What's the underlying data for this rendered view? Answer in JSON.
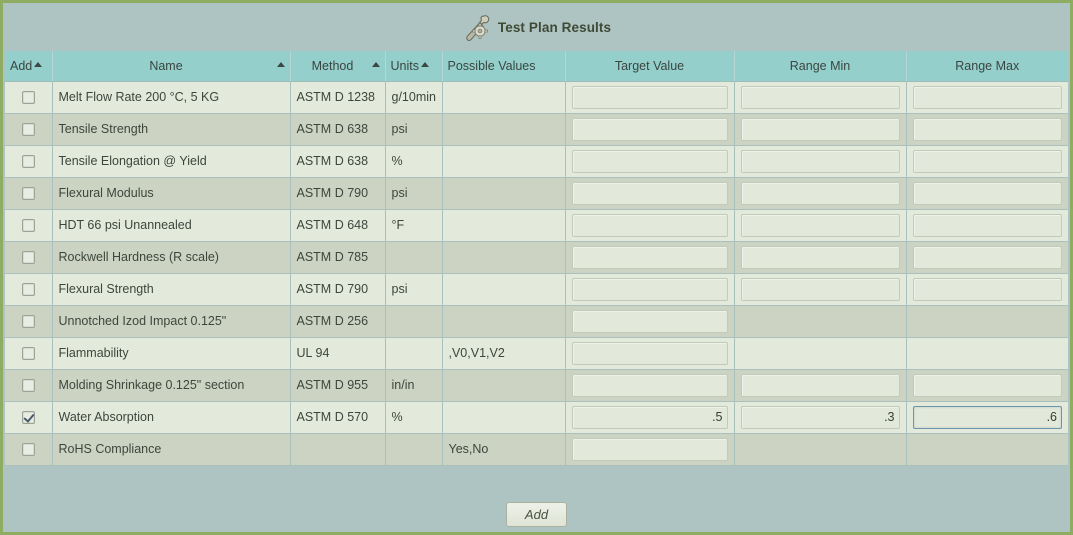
{
  "header": {
    "title": "Test Plan Results",
    "icon": "wrench-gear-icon"
  },
  "colors": {
    "page_background": "#aec4c2",
    "outer_border": "#8fad62",
    "header_row": "#95cfcc",
    "row_odd": "#e3e9db",
    "row_even": "#ccd3c3",
    "input_background": "#e2e8da",
    "focus_border": "#6d94a7",
    "text": "#3c463c"
  },
  "table": {
    "columns": [
      {
        "key": "add",
        "label": "Add",
        "sortable": true,
        "sort": "asc",
        "align": "left"
      },
      {
        "key": "name",
        "label": "Name",
        "sortable": true,
        "sort": "asc",
        "align": "center"
      },
      {
        "key": "method",
        "label": "Method",
        "sortable": true,
        "sort": "asc",
        "align": "center"
      },
      {
        "key": "units",
        "label": "Units",
        "sortable": true,
        "sort": "asc",
        "align": "left"
      },
      {
        "key": "possible",
        "label": "Possible Values",
        "sortable": false,
        "sort": "",
        "align": "left"
      },
      {
        "key": "target",
        "label": "Target Value",
        "sortable": false,
        "sort": "",
        "align": "center"
      },
      {
        "key": "rangemin",
        "label": "Range Min",
        "sortable": false,
        "sort": "",
        "align": "center"
      },
      {
        "key": "rangemax",
        "label": "Range Max",
        "sortable": false,
        "sort": "",
        "align": "center"
      }
    ],
    "rows": [
      {
        "checked": false,
        "name": "Melt Flow Rate 200 °C, 5 KG",
        "method": "ASTM D 1238",
        "units": "g/10min",
        "possible": "",
        "target": {
          "input": true,
          "value": ""
        },
        "rangemin": {
          "input": true,
          "value": ""
        },
        "rangemax": {
          "input": true,
          "value": ""
        }
      },
      {
        "checked": false,
        "name": "Tensile Strength",
        "method": "ASTM D 638",
        "units": "psi",
        "possible": "",
        "target": {
          "input": true,
          "value": ""
        },
        "rangemin": {
          "input": true,
          "value": ""
        },
        "rangemax": {
          "input": true,
          "value": ""
        }
      },
      {
        "checked": false,
        "name": "Tensile Elongation @ Yield",
        "method": "ASTM D 638",
        "units": "%",
        "possible": "",
        "target": {
          "input": true,
          "value": ""
        },
        "rangemin": {
          "input": true,
          "value": ""
        },
        "rangemax": {
          "input": true,
          "value": ""
        }
      },
      {
        "checked": false,
        "name": "Flexural Modulus",
        "method": "ASTM D 790",
        "units": "psi",
        "possible": "",
        "target": {
          "input": true,
          "value": ""
        },
        "rangemin": {
          "input": true,
          "value": ""
        },
        "rangemax": {
          "input": true,
          "value": ""
        }
      },
      {
        "checked": false,
        "name": "HDT 66 psi Unannealed",
        "method": "ASTM D 648",
        "units": "°F",
        "possible": "",
        "target": {
          "input": true,
          "value": ""
        },
        "rangemin": {
          "input": true,
          "value": ""
        },
        "rangemax": {
          "input": true,
          "value": ""
        }
      },
      {
        "checked": false,
        "name": "Rockwell Hardness (R scale)",
        "method": "ASTM D 785",
        "units": "",
        "possible": "",
        "target": {
          "input": true,
          "value": ""
        },
        "rangemin": {
          "input": true,
          "value": ""
        },
        "rangemax": {
          "input": true,
          "value": ""
        }
      },
      {
        "checked": false,
        "name": "Flexural Strength",
        "method": "ASTM D 790",
        "units": "psi",
        "possible": "",
        "target": {
          "input": true,
          "value": ""
        },
        "rangemin": {
          "input": true,
          "value": ""
        },
        "rangemax": {
          "input": true,
          "value": ""
        }
      },
      {
        "checked": false,
        "name": "Unnotched Izod Impact 0.125\"",
        "method": "ASTM D 256",
        "units": "",
        "possible": "",
        "target": {
          "input": true,
          "value": ""
        },
        "rangemin": {
          "input": false,
          "value": ""
        },
        "rangemax": {
          "input": false,
          "value": ""
        }
      },
      {
        "checked": false,
        "name": "Flammability",
        "method": "UL 94",
        "units": "",
        "possible": ",V0,V1,V2",
        "target": {
          "input": true,
          "value": ""
        },
        "rangemin": {
          "input": false,
          "value": ""
        },
        "rangemax": {
          "input": false,
          "value": ""
        }
      },
      {
        "checked": false,
        "name": "Molding Shrinkage 0.125\" section",
        "method": "ASTM D 955",
        "units": "in/in",
        "possible": "",
        "target": {
          "input": true,
          "value": ""
        },
        "rangemin": {
          "input": true,
          "value": ""
        },
        "rangemax": {
          "input": true,
          "value": ""
        }
      },
      {
        "checked": true,
        "name": "Water Absorption",
        "method": "ASTM D 570",
        "units": "%",
        "possible": "",
        "target": {
          "input": true,
          "value": ".5"
        },
        "rangemin": {
          "input": true,
          "value": ".3"
        },
        "rangemax": {
          "input": true,
          "value": ".6",
          "focused": true
        }
      },
      {
        "checked": false,
        "name": "RoHS Compliance",
        "method": "",
        "units": "",
        "possible": "Yes,No",
        "target": {
          "input": true,
          "value": ""
        },
        "rangemin": {
          "input": false,
          "value": ""
        },
        "rangemax": {
          "input": false,
          "value": ""
        }
      }
    ]
  },
  "footer": {
    "add_label": "Add"
  }
}
